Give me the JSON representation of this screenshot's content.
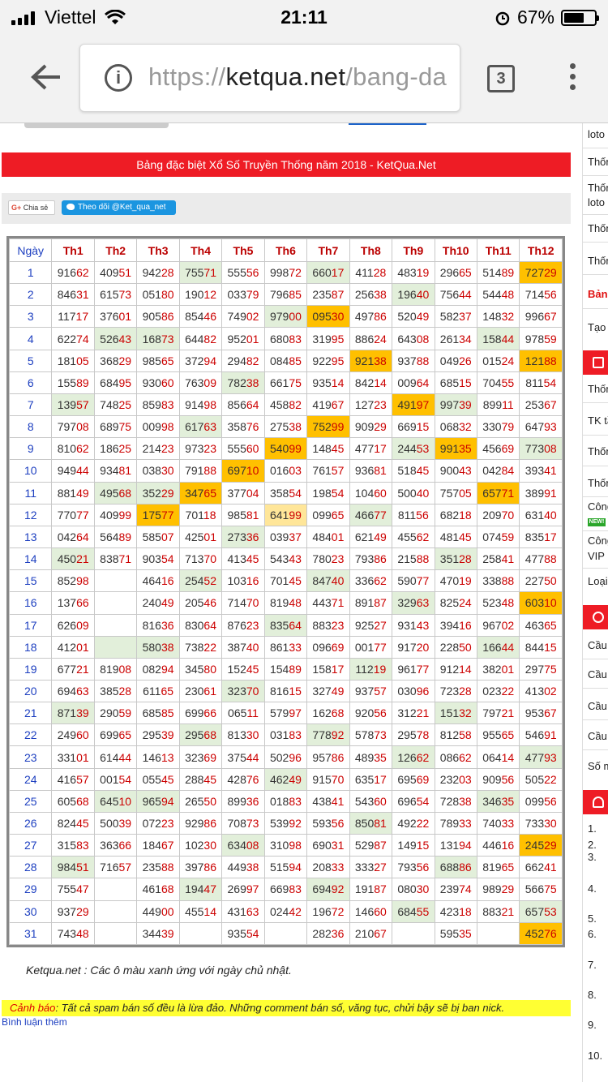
{
  "status": {
    "carrier": "Viettel",
    "time": "21:11",
    "battery": "67%",
    "battery_level": 0.67
  },
  "browser": {
    "url_scheme": "https://",
    "url_host": "ketqua.net",
    "url_path": "/bang-da",
    "tab_count": "3"
  },
  "header": {
    "title": "Bảng đặc biệt Xổ Số Truyền Thống năm 2018 - KetQua.Net"
  },
  "share": {
    "google_label": "Chia sẻ",
    "google_prefix": "G+",
    "twitter_label": "Theo dõi @Ket_qua_net"
  },
  "table": {
    "columns": [
      "Ngày",
      "Th1",
      "Th2",
      "Th3",
      "Th4",
      "Th5",
      "Th6",
      "Th7",
      "Th8",
      "Th9",
      "Th10",
      "Th11",
      "Th12"
    ],
    "rows": [
      [
        "1",
        "91662",
        "40951",
        "94228",
        "75571",
        "55556",
        "99872",
        "66017",
        "41128",
        "48319",
        "29665",
        "51489",
        "72729"
      ],
      [
        "2",
        "84631",
        "61573",
        "05180",
        "19012",
        "03379",
        "79685",
        "23587",
        "25638",
        "19640",
        "75644",
        "54448",
        "71456"
      ],
      [
        "3",
        "11717",
        "37601",
        "90586",
        "85446",
        "74902",
        "97900",
        "09530",
        "49786",
        "52049",
        "58237",
        "14832",
        "99667"
      ],
      [
        "4",
        "62274",
        "52643",
        "16873",
        "64482",
        "95201",
        "68083",
        "31995",
        "88624",
        "64308",
        "26134",
        "15844",
        "97859"
      ],
      [
        "5",
        "18105",
        "36829",
        "98565",
        "37294",
        "29482",
        "08485",
        "92295",
        "92138",
        "93788",
        "04926",
        "01524",
        "12188"
      ],
      [
        "6",
        "15589",
        "68495",
        "93060",
        "76309",
        "78238",
        "66175",
        "93514",
        "84214",
        "00964",
        "68515",
        "70455",
        "81154"
      ],
      [
        "7",
        "13957",
        "74825",
        "85983",
        "91498",
        "85664",
        "45882",
        "41967",
        "12723",
        "49197",
        "99739",
        "89911",
        "25367"
      ],
      [
        "8",
        "79708",
        "68975",
        "00998",
        "61763",
        "35876",
        "27538",
        "75299",
        "90929",
        "66915",
        "06832",
        "33079",
        "64793"
      ],
      [
        "9",
        "81062",
        "18625",
        "21423",
        "97323",
        "55560",
        "54099",
        "14845",
        "47717",
        "24453",
        "99135",
        "45669",
        "77308"
      ],
      [
        "10",
        "94944",
        "93481",
        "03830",
        "79188",
        "69710",
        "01603",
        "76157",
        "93681",
        "51845",
        "90043",
        "04284",
        "39341"
      ],
      [
        "11",
        "88149",
        "49568",
        "35229",
        "34765",
        "37704",
        "35854",
        "19854",
        "10460",
        "50040",
        "75705",
        "65771",
        "38991"
      ],
      [
        "12",
        "77077",
        "40999",
        "17577",
        "70118",
        "98581",
        "64199",
        "09965",
        "46677",
        "81156",
        "68218",
        "20970",
        "63140"
      ],
      [
        "13",
        "04264",
        "56489",
        "58507",
        "42501",
        "27336",
        "03937",
        "48401",
        "62149",
        "45562",
        "48145",
        "07459",
        "83517"
      ],
      [
        "14",
        "45021",
        "83871",
        "90354",
        "71370",
        "41345",
        "54343",
        "78023",
        "79386",
        "21588",
        "35128",
        "25841",
        "47788"
      ],
      [
        "15",
        "85298",
        "",
        "46416",
        "25452",
        "10316",
        "70145",
        "84740",
        "33662",
        "59077",
        "47019",
        "33888",
        "22750"
      ],
      [
        "16",
        "13766",
        "",
        "24049",
        "20546",
        "71470",
        "81948",
        "44371",
        "89187",
        "32963",
        "82524",
        "52348",
        "60310"
      ],
      [
        "17",
        "62609",
        "",
        "81636",
        "83064",
        "87623",
        "83564",
        "88323",
        "92527",
        "93143",
        "39416",
        "96702",
        "46365"
      ],
      [
        "18",
        "41201",
        "",
        "58038",
        "73822",
        "38740",
        "86133",
        "09669",
        "00177",
        "91720",
        "22850",
        "16644",
        "84415"
      ],
      [
        "19",
        "67721",
        "81908",
        "08294",
        "34580",
        "15245",
        "15489",
        "15817",
        "11219",
        "96177",
        "91214",
        "38201",
        "29775"
      ],
      [
        "20",
        "69463",
        "38528",
        "61165",
        "23061",
        "32370",
        "81615",
        "32749",
        "93757",
        "03096",
        "72328",
        "02322",
        "41302"
      ],
      [
        "21",
        "87139",
        "29059",
        "68585",
        "69966",
        "06511",
        "57997",
        "16268",
        "92056",
        "31221",
        "15132",
        "79721",
        "95367"
      ],
      [
        "22",
        "24960",
        "69965",
        "29539",
        "29568",
        "81330",
        "03183",
        "77892",
        "57873",
        "29578",
        "81258",
        "95565",
        "54691"
      ],
      [
        "23",
        "33101",
        "61444",
        "14613",
        "32369",
        "37544",
        "50296",
        "95786",
        "48935",
        "12662",
        "08662",
        "06414",
        "47793"
      ],
      [
        "24",
        "41657",
        "00154",
        "05545",
        "28845",
        "42876",
        "46249",
        "91570",
        "63517",
        "69569",
        "23203",
        "90956",
        "50522"
      ],
      [
        "25",
        "60568",
        "64510",
        "96594",
        "26550",
        "89936",
        "01883",
        "43841",
        "54360",
        "69654",
        "72838",
        "34635",
        "09956"
      ],
      [
        "26",
        "82445",
        "50039",
        "07223",
        "92986",
        "70873",
        "53992",
        "59356",
        "85081",
        "49222",
        "78933",
        "74033",
        "73330"
      ],
      [
        "27",
        "31583",
        "36366",
        "18467",
        "10230",
        "63408",
        "31098",
        "69031",
        "52987",
        "14915",
        "13194",
        "44616",
        "24529"
      ],
      [
        "28",
        "98451",
        "71657",
        "23588",
        "39786",
        "44938",
        "51594",
        "20833",
        "33327",
        "79356",
        "68886",
        "81965",
        "66241"
      ],
      [
        "29",
        "75547",
        "",
        "46168",
        "19447",
        "26997",
        "66983",
        "69492",
        "19187",
        "08030",
        "23974",
        "98929",
        "56675"
      ],
      [
        "30",
        "93729",
        "",
        "44900",
        "45514",
        "43163",
        "02442",
        "19672",
        "14660",
        "68455",
        "42318",
        "88321",
        "65753"
      ],
      [
        "31",
        "74348",
        "",
        "34439",
        "",
        "93554",
        "",
        "28236",
        "21067",
        "",
        "59535",
        "",
        "45276"
      ]
    ]
  },
  "note": "Ketqua.net : Các ô màu xanh ứng với ngày chủ nhật.",
  "warning": {
    "label": "Cảnh báo",
    "text": ": Tất cả spam bán số đều là lừa đảo. Những comment bán số, văng tục, chửi bậy sẽ bị ban nick."
  },
  "more_comments": "Bình luận thêm",
  "sidebar": {
    "items": [
      "loto",
      "Thốn",
      "Thốn",
      "loto",
      "Thốn",
      "Thốn",
      "Bảng",
      "Tạo",
      "Thốn",
      "TK tầ",
      "Thốn",
      "Thốn",
      "Công",
      "Công",
      "VIP",
      "Loại",
      "Cầu",
      "Cầu",
      "Cầu",
      "Cầu",
      "Số m",
      "1.",
      "2.",
      "3.",
      "4.",
      "5.",
      "6.",
      "7.",
      "8.",
      "9.",
      "10."
    ],
    "new_badge": "NEW!"
  }
}
